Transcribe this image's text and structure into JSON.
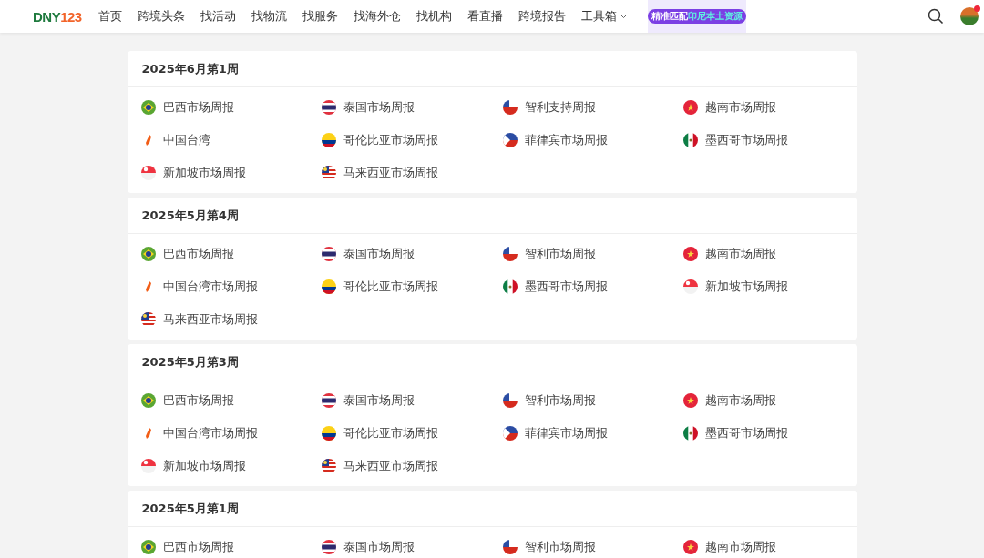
{
  "header": {
    "logo": {
      "part_1": "DNY",
      "part_2": "123"
    },
    "nav": [
      {
        "label": "首页",
        "dropdown": false
      },
      {
        "label": "跨境头条",
        "dropdown": false
      },
      {
        "label": "找活动",
        "dropdown": false
      },
      {
        "label": "找物流",
        "dropdown": false
      },
      {
        "label": "找服务",
        "dropdown": false
      },
      {
        "label": "找海外仓",
        "dropdown": false
      },
      {
        "label": "找机构",
        "dropdown": false
      },
      {
        "label": "看直播",
        "dropdown": false
      },
      {
        "label": "跨境报告",
        "dropdown": false
      },
      {
        "label": "工具箱",
        "dropdown": true
      }
    ],
    "banner": {
      "text": "精准匹配",
      "highlight": "印尼本土资源"
    },
    "avatar": {
      "notification": true
    }
  },
  "weeks": [
    {
      "title": "2025年6月第1周",
      "reports": [
        {
          "label": "巴西市场周报",
          "kind": "br"
        },
        {
          "label": "泰国市场周报",
          "kind": "th"
        },
        {
          "label": "智利支持周报",
          "kind": "cl"
        },
        {
          "label": "越南市场周报",
          "kind": "vn"
        },
        {
          "label": "中国台湾",
          "kind": "tw"
        },
        {
          "label": "哥伦比亚市场周报",
          "kind": "co"
        },
        {
          "label": "菲律宾市场周报",
          "kind": "ph"
        },
        {
          "label": "墨西哥市场周报",
          "kind": "mx"
        },
        {
          "label": "新加坡市场周报",
          "kind": "sg"
        },
        {
          "label": "马来西亚市场周报",
          "kind": "my"
        }
      ]
    },
    {
      "title": "2025年5月第4周",
      "reports": [
        {
          "label": "巴西市场周报",
          "kind": "br"
        },
        {
          "label": "泰国市场周报",
          "kind": "th"
        },
        {
          "label": "智利市场周报",
          "kind": "cl"
        },
        {
          "label": "越南市场周报",
          "kind": "vn"
        },
        {
          "label": "中国台湾市场周报",
          "kind": "tw"
        },
        {
          "label": "哥伦比亚市场周报",
          "kind": "co"
        },
        {
          "label": "墨西哥市场周报",
          "kind": "mx"
        },
        {
          "label": "新加坡市场周报",
          "kind": "sg"
        },
        {
          "label": "马来西亚市场周报",
          "kind": "my"
        }
      ]
    },
    {
      "title": "2025年5月第3周",
      "reports": [
        {
          "label": "巴西市场周报",
          "kind": "br"
        },
        {
          "label": "泰国市场周报",
          "kind": "th"
        },
        {
          "label": "智利市场周报",
          "kind": "cl"
        },
        {
          "label": "越南市场周报",
          "kind": "vn"
        },
        {
          "label": "中国台湾市场周报",
          "kind": "tw"
        },
        {
          "label": "哥伦比亚市场周报",
          "kind": "co"
        },
        {
          "label": "菲律宾市场周报",
          "kind": "ph"
        },
        {
          "label": "墨西哥市场周报",
          "kind": "mx"
        },
        {
          "label": "新加坡市场周报",
          "kind": "sg"
        },
        {
          "label": "马来西亚市场周报",
          "kind": "my"
        }
      ]
    },
    {
      "title": "2025年5月第1周",
      "reports": [
        {
          "label": "巴西市场周报",
          "kind": "br"
        },
        {
          "label": "泰国市场周报",
          "kind": "th"
        },
        {
          "label": "智利市场周报",
          "kind": "cl"
        },
        {
          "label": "越南市场周报",
          "kind": "vn"
        }
      ]
    }
  ]
}
